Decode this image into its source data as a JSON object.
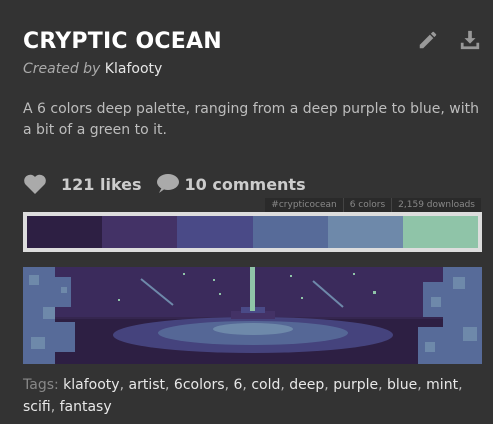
{
  "palette": {
    "title": "CRYPTIC OCEAN",
    "created_by_label": "Created by",
    "author": "Klafooty",
    "description": "A 6 colors deep palette, ranging from a deep purple to blue, with a bit of a green to it.",
    "likes": "121 likes",
    "comments": "10 comments",
    "hashtag": "#crypticocean",
    "color_count": "6 colors",
    "downloads": "2,159 downloads",
    "colors": [
      "#2d1f43",
      "#433266",
      "#4a4a87",
      "#576b99",
      "#6e89aa",
      "#8fc4a8"
    ]
  },
  "icons": {
    "edit": "pencil-icon",
    "download": "download-icon",
    "like": "heart-icon",
    "comment": "comment-icon"
  },
  "tags": {
    "label": "Tags:",
    "items": [
      "klafooty",
      "artist",
      "6colors",
      "6",
      "cold",
      "deep",
      "purple",
      "blue",
      "mint",
      "scifi",
      "fantasy"
    ]
  }
}
